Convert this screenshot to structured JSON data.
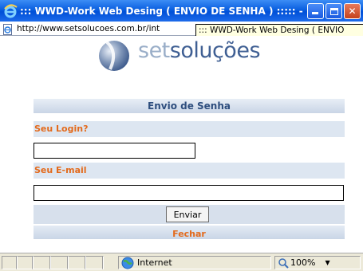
{
  "window": {
    "title": "::: WWD-Work Web Desing ( ENVIO DE SENHA ) ::::: - ...",
    "minimize_icon": "minimize-icon",
    "maximize_icon": "maximize-icon",
    "close_icon": "close-icon",
    "close_glyph": "✕"
  },
  "address": {
    "url": "http://www.setsolucoes.com.br/int",
    "tooltip": "::: WWD-Work Web Desing ( ENVIO"
  },
  "logo": {
    "prefix": "set",
    "suffix": "soluções"
  },
  "form": {
    "title": "Envio de Senha",
    "login_label": "Seu Login?",
    "login_value": "",
    "email_label": "Seu E-mail",
    "email_value": "",
    "submit_label": "Enviar",
    "close_label": "Fechar"
  },
  "status": {
    "zone": "Internet",
    "zoom": "100%"
  },
  "colors": {
    "accent_orange": "#e36a1c",
    "header_blue": "#2e4e7e",
    "titlebar_blue": "#0a5fe0"
  }
}
